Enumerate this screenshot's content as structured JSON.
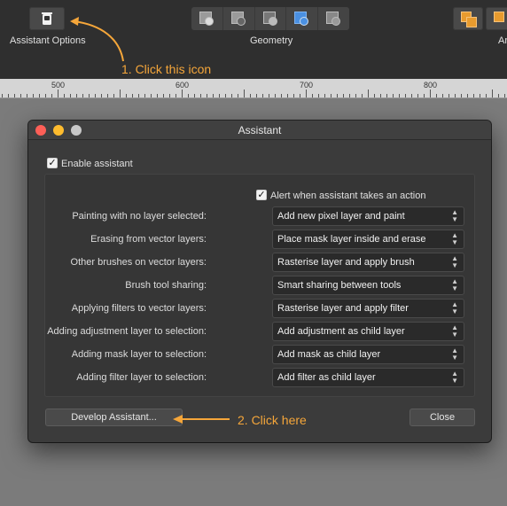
{
  "toolbar": {
    "assistant_options_label": "Assistant Options",
    "geometry_label": "Geometry",
    "right_label_fragment": "Ar",
    "icons": {
      "assistant": "assistant-trash-icon",
      "geometry": [
        "add-geometry-icon",
        "subtract-geometry-icon",
        "intersect-geometry-icon",
        "xor-geometry-icon",
        "divide-geometry-icon"
      ],
      "arrange": [
        "arrange-forward-icon",
        "arrange-back-icon"
      ]
    }
  },
  "annotations": {
    "step1": "1. Click this icon",
    "step2": "2. Click here",
    "color": "#f5a63a"
  },
  "ruler": {
    "ticks": [
      "500",
      "600",
      "700",
      "800"
    ]
  },
  "dialog": {
    "title": "Assistant",
    "enable_assistant": {
      "label": "Enable assistant",
      "checked": true
    },
    "alert": {
      "label": "Alert when assistant takes an action",
      "checked": true
    },
    "rows": [
      {
        "label": "Painting with no layer selected:",
        "value": "Add new pixel layer and paint"
      },
      {
        "label": "Erasing from vector layers:",
        "value": "Place mask layer inside and erase"
      },
      {
        "label": "Other brushes on vector layers:",
        "value": "Rasterise layer and apply brush"
      },
      {
        "label": "Brush tool sharing:",
        "value": "Smart sharing between tools"
      },
      {
        "label": "Applying filters to vector layers:",
        "value": "Rasterise layer and apply filter"
      },
      {
        "label": "Adding adjustment layer to selection:",
        "value": "Add adjustment as child layer"
      },
      {
        "label": "Adding mask layer to selection:",
        "value": "Add mask as child layer"
      },
      {
        "label": "Adding filter layer to selection:",
        "value": "Add filter as child layer"
      }
    ],
    "develop_button": "Develop Assistant...",
    "close_button": "Close",
    "traffic_colors": [
      "#fd5f57",
      "#febc2e",
      "#c8c8c8"
    ]
  }
}
